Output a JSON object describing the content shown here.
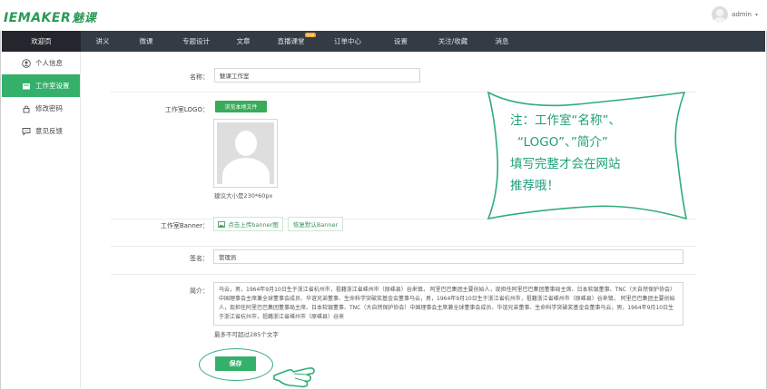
{
  "header": {
    "logo_en": "IEMAKER",
    "logo_cn": "魅课",
    "username": "admin"
  },
  "nav": {
    "items": [
      {
        "label": "欢迎页"
      },
      {
        "label": "讲义"
      },
      {
        "label": "微课"
      },
      {
        "label": "专题设计"
      },
      {
        "label": "文章"
      },
      {
        "label": "直播课堂",
        "badge": "new"
      },
      {
        "label": "订单中心"
      },
      {
        "label": "设置"
      },
      {
        "label": "关注/收藏"
      },
      {
        "label": "消息"
      }
    ]
  },
  "sidebar": {
    "items": [
      {
        "label": "个人信息",
        "icon": "user-icon"
      },
      {
        "label": "工作室设置",
        "icon": "folder-icon"
      },
      {
        "label": "修改密码",
        "icon": "lock-icon"
      },
      {
        "label": "意见反馈",
        "icon": "chat-icon"
      }
    ]
  },
  "form": {
    "name_label": "名称：",
    "name_value": "魅课工作室",
    "logo_label": "工作室LOGO：",
    "logo_button": "浏览本地文件",
    "logo_hint": "建议大小是230*60px",
    "banner_label": "工作室Banner：",
    "banner_upload": "点击上传banner图",
    "banner_restore": "恢复默认Banner",
    "sign_label": "签名：",
    "sign_value": "管理员",
    "intro_label": "简介：",
    "intro_value": "马云，男，1964年9月10日生于浙江省杭州市，祖籍浙江省嵊州市（原嵊县）谷来镇， 阿里巴巴集团主要创始人，现担任阿里巴巴集团董事局主席、日本软银董事、TNC（大自然保护协会）中国理事会主席兼全球董事会成员、华谊兄弟董事、生命科学突破奖基金会董事马云，男，1964年9月10日生于浙江省杭州市，祖籍浙江省嵊州市（原嵊县）谷来镇， 阿里巴巴集团主要创始人，现担任阿里巴巴集团董事局主席、日本软银董事、TNC（大自然保护协会）中国理事会主席兼全球董事会成员、华谊兄弟董事、生命科学突破奖基金会董事马云，男，1964年9月10日生于浙江省杭州市，祖籍浙江省嵊州市（原嵊县）谷来",
    "intro_hint": "最多不可超过285个文字",
    "save_button": "保存"
  },
  "callout": {
    "line1": "注：工作室“名称”、",
    "line2": "“LOGO”、”简介”",
    "line3": "填写完整才会在网站",
    "line4": "推荐哦！"
  },
  "colors": {
    "accent": "#35b06a",
    "nav_bg": "#333b45",
    "callout": "#1fa07a"
  }
}
